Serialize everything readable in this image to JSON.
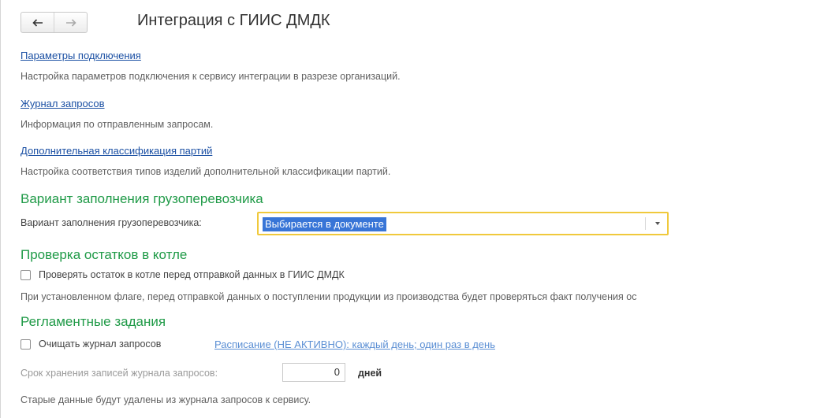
{
  "header": {
    "back_icon": "arrow-left-icon",
    "forward_icon": "arrow-right-icon",
    "title": "Интеграция с ГИИС ДМДК"
  },
  "links": [
    {
      "label": "Параметры подключения",
      "description": "Настройка параметров подключения к сервису интеграции в разрезе организаций."
    },
    {
      "label": "Журнал запросов",
      "description": "Информация по отправленным запросам."
    },
    {
      "label": "Дополнительная классификация партий",
      "description": "Настройка соответствия типов изделий дополнительной классификации партий."
    }
  ],
  "carrier": {
    "section_title": "Вариант заполнения грузоперевозчика",
    "field_label": "Вариант заполнения грузоперевозчика:",
    "selected_value": "Выбирается в документе"
  },
  "balance_check": {
    "section_title": "Проверка остатков в котле",
    "checkbox_label": "Проверять остаток в котле перед отправкой данных в ГИИС ДМДК",
    "checked": false,
    "hint": "При установленном флаге, перед отправкой данных о поступлении продукции из производства будет проверяться факт получения ос"
  },
  "scheduled": {
    "section_title": "Регламентные задания",
    "checkbox_label": "Очищать журнал запросов",
    "checked": false,
    "schedule_link": "Расписание (НЕ АКТИВНО): каждый день; один раз в день",
    "retention_label": "Срок хранения записей журнала запросов:",
    "retention_value": "0",
    "retention_unit": "дней",
    "note": "Старые данные будут удалены из журнала запросов к сервису."
  },
  "colors": {
    "section_title": "#1f9a47",
    "link": "#1a4fa3",
    "focus_border": "#f0c93c",
    "selection": "#3875d7"
  }
}
